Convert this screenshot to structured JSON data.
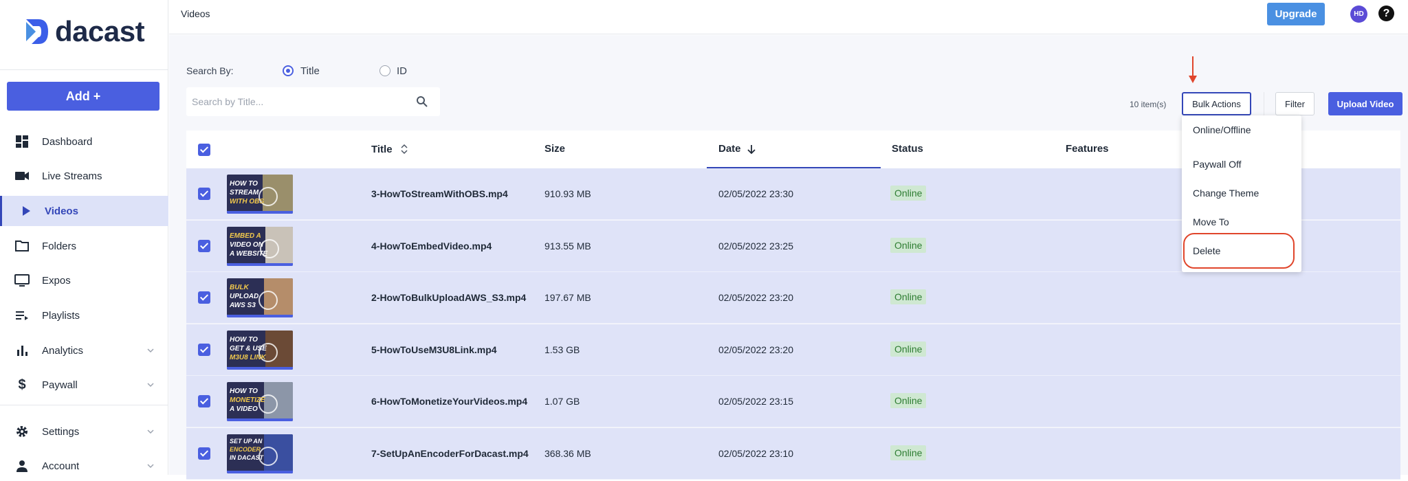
{
  "brand": {
    "name": "dacast",
    "accent": "#4a5fe0",
    "primary_dark": "#3346b8"
  },
  "sidebar": {
    "add_label": "Add +",
    "items": [
      {
        "label": "Dashboard",
        "icon": "dashboard-icon"
      },
      {
        "label": "Live Streams",
        "icon": "video-camera-icon"
      },
      {
        "label": "Videos",
        "icon": "play-icon",
        "active": true
      },
      {
        "label": "Folders",
        "icon": "folder-icon"
      },
      {
        "label": "Expos",
        "icon": "monitor-icon"
      },
      {
        "label": "Playlists",
        "icon": "playlist-icon"
      },
      {
        "label": "Analytics",
        "icon": "bar-chart-icon",
        "expandable": true
      },
      {
        "label": "Paywall",
        "icon": "dollar-icon",
        "expandable": true
      },
      {
        "label": "Settings",
        "icon": "gear-icon",
        "expandable": true
      },
      {
        "label": "Account",
        "icon": "person-icon",
        "expandable": true
      }
    ]
  },
  "header": {
    "title": "Videos",
    "upgrade_label": "Upgrade",
    "avatar_initials": "HD",
    "help_label": "?"
  },
  "search": {
    "label": "Search By:",
    "options": [
      {
        "label": "Title",
        "selected": true
      },
      {
        "label": "ID",
        "selected": false
      }
    ],
    "placeholder": "Search by Title..."
  },
  "toolbar": {
    "item_count": "10 item(s)",
    "bulk_actions_label": "Bulk Actions",
    "filter_label": "Filter",
    "upload_label": "Upload Video"
  },
  "table": {
    "columns": [
      "Title",
      "Size",
      "Date",
      "Status",
      "Features"
    ],
    "rows": [
      {
        "thumb_text": "HOW TO STREAM WITH OBS",
        "title": "3-HowToStreamWithOBS.mp4",
        "size": "910.93 MB",
        "date": "02/05/2022 23:30",
        "status": "Online"
      },
      {
        "thumb_text": "EMBED A VIDEO ON A WEBSITE",
        "title": "4-HowToEmbedVideo.mp4",
        "size": "913.55 MB",
        "date": "02/05/2022 23:25",
        "status": "Online"
      },
      {
        "thumb_text": "BULK UPLOAD AWS S3",
        "title": "2-HowToBulkUploadAWS_S3.mp4",
        "size": "197.67 MB",
        "date": "02/05/2022 23:20",
        "status": "Online"
      },
      {
        "thumb_text": "HOW TO GET & USE M3U8 LINK",
        "title": "5-HowToUseM3U8Link.mp4",
        "size": "1.53 GB",
        "date": "02/05/2022 23:20",
        "status": "Online"
      },
      {
        "thumb_text": "HOW TO MONETIZE A VIDEO",
        "title": "6-HowToMonetizeYourVideos.mp4",
        "size": "1.07 GB",
        "date": "02/05/2022 23:15",
        "status": "Online"
      },
      {
        "thumb_text": "SET UP AN ENCODER IN DACAST",
        "title": "7-SetUpAnEncoderForDacast.mp4",
        "size": "368.36 MB",
        "date": "02/05/2022 23:10",
        "status": "Online"
      }
    ]
  },
  "bulk_menu": {
    "items": [
      "Online/Offline",
      "Paywall Off",
      "Change Theme",
      "Move To",
      "Delete"
    ],
    "highlighted": "Delete"
  }
}
